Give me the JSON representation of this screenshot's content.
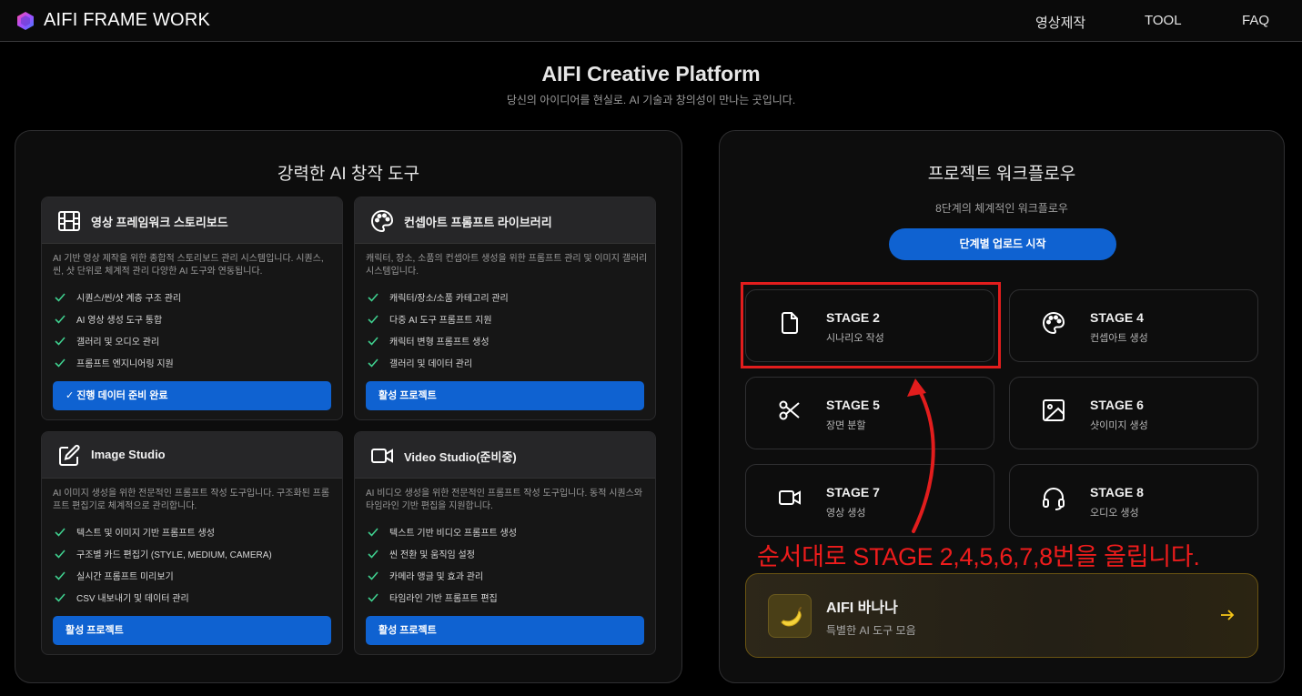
{
  "header": {
    "brand": "AIFI FRAME WORK",
    "nav": [
      "영상제작",
      "TOOL",
      "FAQ"
    ]
  },
  "hero": {
    "title": "AIFI Creative Platform",
    "subtitle": "당신의 아이디어를 현실로. AI 기술과 창의성이 만나는 곳입니다."
  },
  "tools": {
    "title": "강력한 AI 창작 도구",
    "cards": [
      {
        "icon": "film-icon",
        "title": "영상 프레임워크 스토리보드",
        "desc": "AI 기반 영상 제작을 위한 종합적 스토리보드 관리 시스템입니다. 시퀀스, 씬, 샷 단위로 체계적 관리 다양한 AI 도구와 연동됩니다.",
        "items": [
          "시퀀스/씬/샷 계층 구조 관리",
          "AI 영상 생성 도구 통합",
          "갤러리 및 오디오 관리",
          "프롬프트 엔지니어링 지원"
        ],
        "button": "✓ 진행 데이터 준비 완료"
      },
      {
        "icon": "palette-icon",
        "title": "컨셉아트 프롬프트 라이브러리",
        "desc": "캐릭터, 장소, 소품의 컨셉아트 생성을 위한 프롬프트 관리 및 이미지 갤러리 시스템입니다.",
        "items": [
          "캐릭터/장소/소품 카테고리 관리",
          "다중 AI 도구 프롬프트 지원",
          "캐릭터 변형 프롬프트 생성",
          "갤러리 및 데이터 관리"
        ],
        "button": "활성 프로젝트"
      },
      {
        "icon": "edit-icon",
        "title": "Image Studio",
        "desc": "AI 이미지 생성을 위한 전문적인 프롬프트 작성 도구입니다. 구조화된 프롬프트 편집기로 체계적으로 관리합니다.",
        "items": [
          "텍스트 및 이미지 기반 프롬프트 생성",
          "구조별 카드 편집기 (STYLE, MEDIUM, CAMERA)",
          "실시간 프롬프트 미리보기",
          "CSV 내보내기 및 데이터 관리"
        ],
        "button": "활성 프로젝트"
      },
      {
        "icon": "video-icon",
        "title": "Video Studio(준비중)",
        "desc": "AI 비디오 생성을 위한 전문적인 프롬프트 작성 도구입니다. 동적 시퀀스와 타임라인 기반 편집을 지원합니다.",
        "items": [
          "텍스트 기반 비디오 프롬프트 생성",
          "씬 전환 및 움직임 설정",
          "카메라 앵글 및 효과 관리",
          "타임라인 기반 프롬프트 편집"
        ],
        "button": "활성 프로젝트"
      }
    ]
  },
  "workflow": {
    "title": "프로젝트 워크플로우",
    "subtitle": "8단계의 체계적인 워크플로우",
    "button": "단계별 업로드 시작",
    "stages": [
      {
        "title": "STAGE 2",
        "sub": "시나리오 작성",
        "icon": "file-icon"
      },
      {
        "title": "STAGE 4",
        "sub": "컨셉아트 생성",
        "icon": "palette-icon"
      },
      {
        "title": "STAGE 5",
        "sub": "장면 분할",
        "icon": "scissors-icon"
      },
      {
        "title": "STAGE 6",
        "sub": "샷이미지 생성",
        "icon": "image-icon"
      },
      {
        "title": "STAGE 7",
        "sub": "영상 생성",
        "icon": "video-icon"
      },
      {
        "title": "STAGE 8",
        "sub": "오디오 생성",
        "icon": "headphones-icon"
      }
    ],
    "banana": {
      "title": "AIFI 바나나",
      "sub": "특별한 AI 도구 모음",
      "emoji": "🍌"
    }
  },
  "annotation": "순서대로 STAGE 2,4,5,6,7,8번을 올립니다.",
  "colors": {
    "accent": "#0f62d1",
    "check": "#3fcf8e",
    "annotation": "#e21d1d",
    "banana_border": "#6a5412"
  }
}
